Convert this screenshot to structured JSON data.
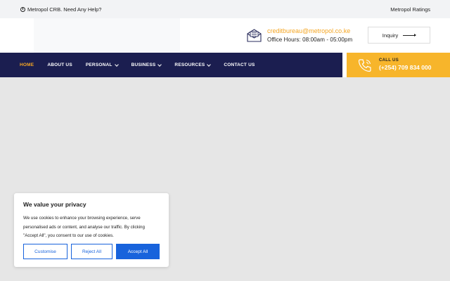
{
  "topbar": {
    "help_text": "Metropol CRB. Need Any Help?",
    "ratings_link": "Metropol Ratings"
  },
  "header": {
    "email": "creditbureau@metropol.co.ke",
    "office_hours": "Office Hours: 08:00am - 05:00pm",
    "inquiry_label": "Inquiry"
  },
  "nav": {
    "items": [
      {
        "label": "HOME"
      },
      {
        "label": "ABOUT US"
      },
      {
        "label": "PERSONAL"
      },
      {
        "label": "BUSINESS"
      },
      {
        "label": "RESOURCES"
      },
      {
        "label": "CONTACT US"
      }
    ]
  },
  "callus": {
    "label": "CALL US",
    "number": "(+254) 709 834 000"
  },
  "cookie": {
    "title": "We value your privacy",
    "text": "We use cookies to enhance your browsing experience, serve personalised ads or content, and analyse our traffic. By clicking \"Accept All\", you consent to our use of cookies.",
    "customise_label": "Customise",
    "reject_label": "Reject All",
    "accept_label": "Accept All"
  },
  "colors": {
    "navy": "#1b1e50",
    "accent": "#f5a623",
    "callus_bg": "#f7b52b",
    "cookie_blue": "#1863dc"
  }
}
